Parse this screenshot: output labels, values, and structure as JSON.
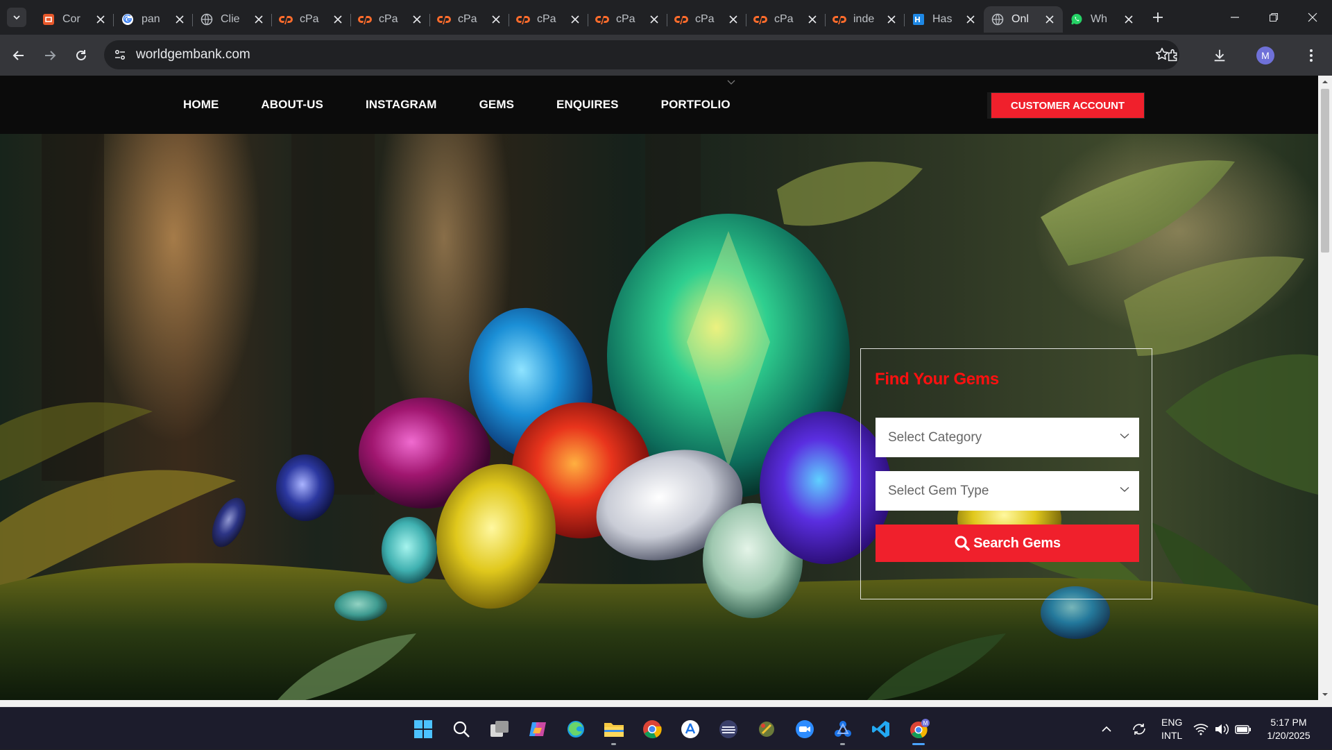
{
  "browser": {
    "tabs": [
      {
        "title": "Cor",
        "icon": "orange-square-icon"
      },
      {
        "title": "pan",
        "icon": "google-icon"
      },
      {
        "title": "Clie",
        "icon": "globe-icon"
      },
      {
        "title": "cPa",
        "icon": "cpanel-icon"
      },
      {
        "title": "cPa",
        "icon": "cpanel-icon"
      },
      {
        "title": "cPa",
        "icon": "cpanel-icon"
      },
      {
        "title": "cPa",
        "icon": "cpanel-icon"
      },
      {
        "title": "cPa",
        "icon": "cpanel-icon"
      },
      {
        "title": "cPa",
        "icon": "cpanel-icon"
      },
      {
        "title": "cPa",
        "icon": "cpanel-icon"
      },
      {
        "title": "inde",
        "icon": "cpanel-icon"
      },
      {
        "title": "Has",
        "icon": "blue-square-icon"
      },
      {
        "title": "Onl",
        "icon": "globe-icon",
        "active": true
      },
      {
        "title": "Wh",
        "icon": "whatsapp-icon"
      }
    ],
    "url": "worldgembank.com",
    "profile_initial": "M"
  },
  "site": {
    "nav": [
      "HOME",
      "ABOUT-US",
      "INSTAGRAM",
      "GEMS",
      "ENQUIRES",
      "PORTFOLIO"
    ],
    "customer_button": "CUSTOMER ACCOUNT",
    "finder": {
      "title": "Find Your Gems",
      "category_placeholder": "Select Category",
      "gem_type_placeholder": "Select Gem Type",
      "search_label": "Search Gems"
    }
  },
  "taskbar": {
    "apps": [
      "windows-start-icon",
      "search-icon",
      "task-view-icon",
      "copilot-icon",
      "edge-icon",
      "file-explorer-icon",
      "chrome-icon",
      "app-store-icon",
      "drive-icon",
      "brush-app-icon",
      "zoom-icon",
      "network-app-icon",
      "vscode-icon",
      "chrome-profile-icon"
    ],
    "language": "ENG",
    "keyboard": "INTL",
    "time": "5:17 PM",
    "date": "1/20/2025"
  },
  "colors": {
    "accent_red": "#f0202c",
    "finder_title": "#ff1010",
    "chrome_dark": "#202124",
    "nav_bg": "#0b0b0b"
  }
}
